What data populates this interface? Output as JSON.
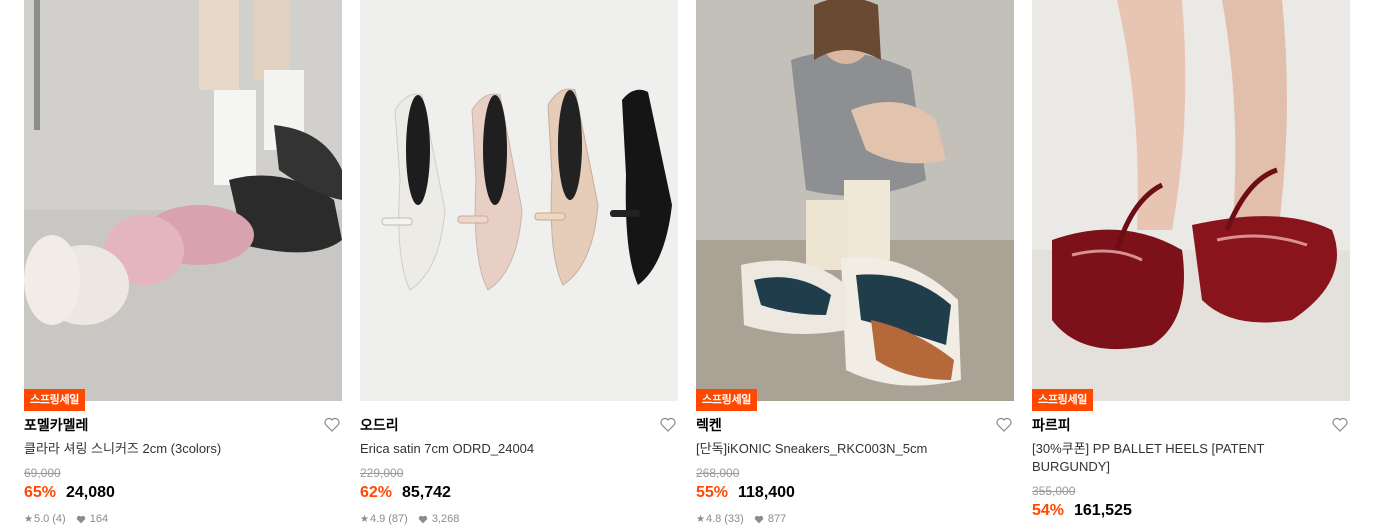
{
  "products": [
    {
      "badge": "스프링세일",
      "brand": "포멜카멜레",
      "name": "클라라 셔링 스니커즈 2cm (3colors)",
      "original_price": "69,000",
      "discount": "65%",
      "price": "24,080",
      "rating": "5.0",
      "reviews": "(4)",
      "likes": "164"
    },
    {
      "badge": "",
      "brand": "오드리",
      "name": "Erica satin 7cm ODRD_24004",
      "original_price": "229,000",
      "discount": "62%",
      "price": "85,742",
      "rating": "4.9",
      "reviews": "(87)",
      "likes": "3,268"
    },
    {
      "badge": "스프링세일",
      "brand": "렉켄",
      "name": "[단독]iKONIC Sneakers_RKC003N_5cm",
      "original_price": "268,000",
      "discount": "55%",
      "price": "118,400",
      "rating": "4.8",
      "reviews": "(33)",
      "likes": "877"
    },
    {
      "badge": "스프링세일",
      "brand": "파르피",
      "name": "[30%쿠폰] PP BALLET HEELS [PATENT BURGUNDY]",
      "original_price": "355,000",
      "discount": "54%",
      "price": "161,525",
      "rating": "",
      "reviews": "",
      "likes": ""
    }
  ],
  "icons": {
    "wishlist": "heart-outline-icon",
    "rating": "star-icon",
    "likes": "heart-filled-icon"
  },
  "colors": {
    "accent": "#ff4800",
    "muted_text": "#9a9a9a"
  }
}
